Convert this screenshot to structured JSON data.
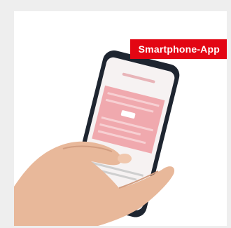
{
  "badge": {
    "label": "Smartphone-App"
  },
  "colors": {
    "accent": "#e30613",
    "frame": "#eeeeee",
    "card": "#ffffff"
  },
  "image": {
    "subject": "hand-holding-smartphone"
  }
}
